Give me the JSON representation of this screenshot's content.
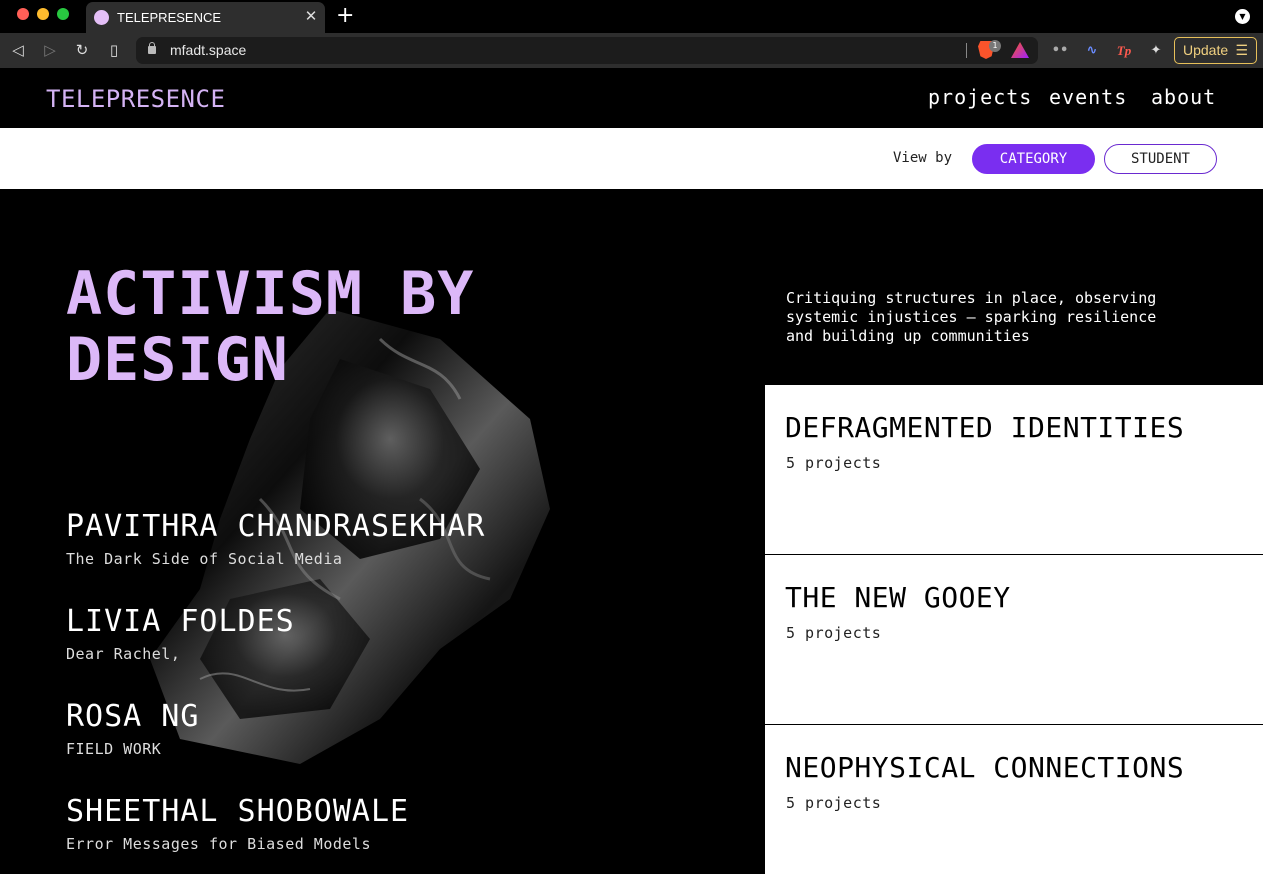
{
  "browser": {
    "tab_title": "TELEPRESENCE",
    "url": "mfadt.space",
    "brave_badge": "1",
    "update_label": "Update"
  },
  "site": {
    "logo": "TELEPRESENCE",
    "nav": [
      "projects",
      "events",
      "about"
    ]
  },
  "view_by": {
    "label": "View by",
    "options": [
      "CATEGORY",
      "STUDENT"
    ],
    "selected": "CATEGORY"
  },
  "category": {
    "title": "ACTIVISM BY DESIGN",
    "description": "Critiquing structures in place, observing systemic injustices — sparking resilience and building up communities"
  },
  "students": [
    {
      "name": "PAVITHRA CHANDRASEKHAR",
      "project": "The Dark Side of Social Media"
    },
    {
      "name": "LIVIA FOLDES",
      "project": "Dear Rachel,"
    },
    {
      "name": "ROSA NG",
      "project": "FIELD WORK"
    },
    {
      "name": "SHEETHAL SHOBOWALE",
      "project": "Error Messages for Biased Models"
    }
  ],
  "categories": [
    {
      "title": "DEFRAGMENTED IDENTITIES",
      "count": "5 projects"
    },
    {
      "title": "THE NEW GOOEY",
      "count": "5 projects"
    },
    {
      "title": "NEOPHYSICAL CONNECTIONS",
      "count": "5 projects"
    }
  ],
  "colors": {
    "accent": "#7a2ef0",
    "title_lavender": "#dcb8f8",
    "logo": "#d4b3f4"
  },
  "icons": {
    "back": "◁",
    "forward": "▷",
    "reload": "↻",
    "bookmark": "▯",
    "close": "✕",
    "new_tab": "+",
    "tab_menu": "▼",
    "ext_1": "••",
    "ext_2": "∿",
    "ext_3": "Tp",
    "ext_puzzle": "✦",
    "update_menu": "☰"
  }
}
